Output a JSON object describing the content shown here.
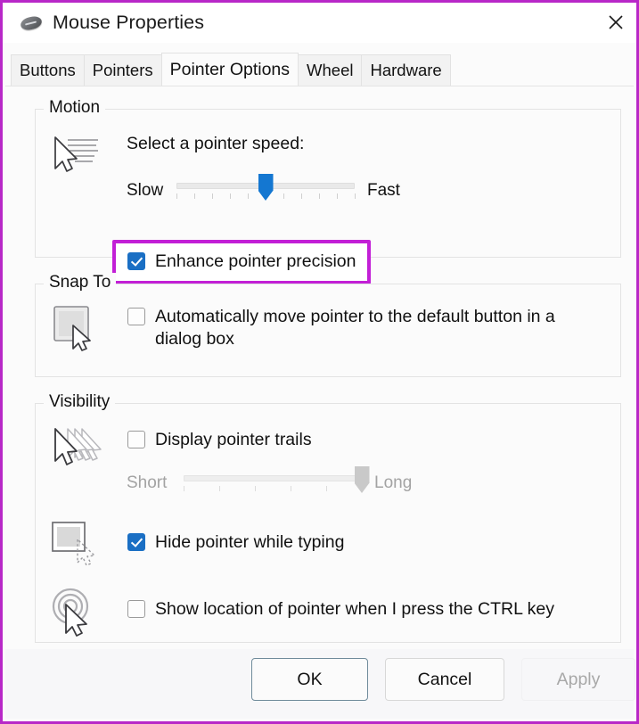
{
  "window": {
    "title": "Mouse Properties",
    "icon": "mouse-icon",
    "close_icon": "close-icon"
  },
  "tabs": [
    {
      "label": "Buttons",
      "active": false
    },
    {
      "label": "Pointers",
      "active": false
    },
    {
      "label": "Pointer Options",
      "active": true
    },
    {
      "label": "Wheel",
      "active": false
    },
    {
      "label": "Hardware",
      "active": false
    }
  ],
  "motion": {
    "group_title": "Motion",
    "icon": "pointer-speed-icon",
    "speed_label": "Select a pointer speed:",
    "slider": {
      "min_label": "Slow",
      "max_label": "Fast",
      "value_percent": 50,
      "tick_count": 11,
      "enabled": true
    },
    "enhance_precision": {
      "label": "Enhance pointer precision",
      "checked": true,
      "highlighted": true
    }
  },
  "snap_to": {
    "group_title": "Snap To",
    "icon": "default-button-cursor-icon",
    "auto_move": {
      "label": "Automatically move pointer to the default button in a dialog box",
      "checked": false
    }
  },
  "visibility": {
    "group_title": "Visibility",
    "trails_icon": "pointer-trails-icon",
    "hide_icon": "hide-pointer-typing-icon",
    "locate_icon": "locate-pointer-icon",
    "display_trails": {
      "label": "Display pointer trails",
      "checked": false
    },
    "trails_slider": {
      "min_label": "Short",
      "max_label": "Long",
      "value_percent": 100,
      "tick_count": 6,
      "enabled": false
    },
    "hide_while_typing": {
      "label": "Hide pointer while typing",
      "checked": true
    },
    "show_location": {
      "label": "Show location of pointer when I press the CTRL key",
      "checked": false
    }
  },
  "footer": {
    "ok": "OK",
    "cancel": "Cancel",
    "apply": "Apply",
    "apply_enabled": false
  },
  "colors": {
    "annotation": "#c21fd6",
    "window_border": "#b828c8",
    "accent_blue": "#1a6fc4",
    "slider_blue": "#1477d1"
  }
}
